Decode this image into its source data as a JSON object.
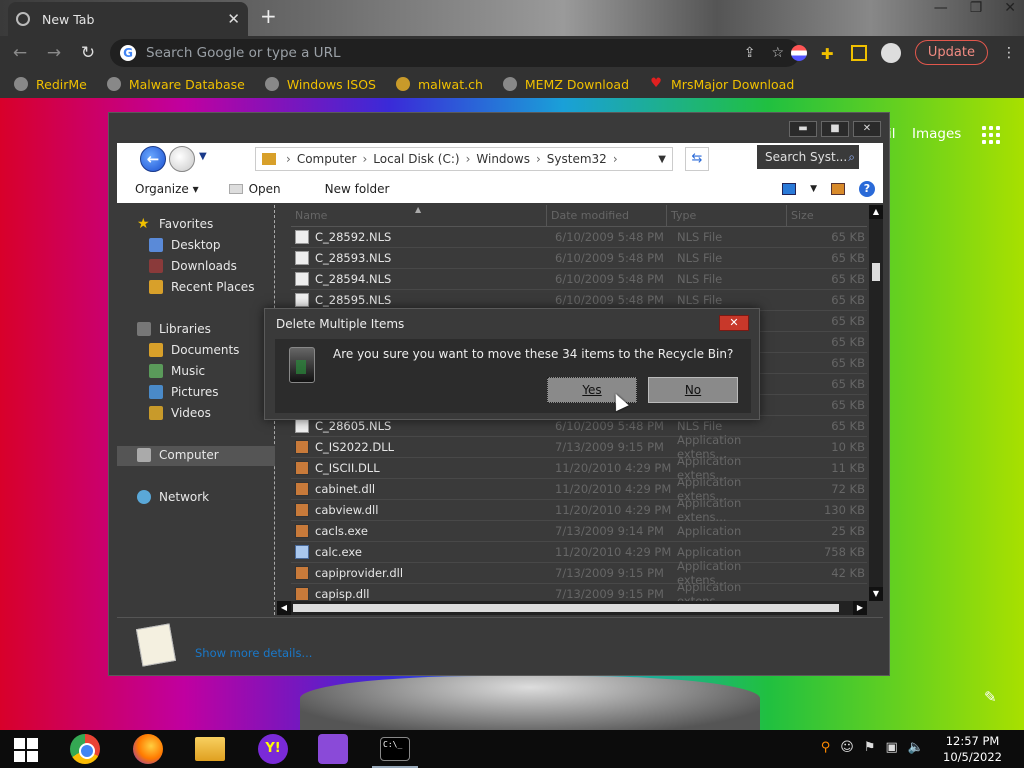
{
  "browser": {
    "tab_title": "New Tab",
    "omnibox_placeholder": "Search Google or type a URL",
    "update_label": "Update",
    "bookmarks": [
      "RedirMe",
      "Malware Database",
      "Windows ISOS",
      "malwat.ch",
      "MEMZ Download",
      "MrsMajor Download"
    ]
  },
  "page": {
    "gmail_partial": "il",
    "images_label": "Images"
  },
  "explorer": {
    "breadcrumb": [
      "Computer",
      "Local Disk (C:)",
      "Windows",
      "System32"
    ],
    "search_placeholder": "Search Syst...",
    "commands": {
      "organize": "Organize",
      "open": "Open",
      "new_folder": "New folder"
    },
    "nav": {
      "favorites": "Favorites",
      "desktop": "Desktop",
      "downloads": "Downloads",
      "recent_places": "Recent Places",
      "libraries": "Libraries",
      "documents": "Documents",
      "music": "Music",
      "pictures": "Pictures",
      "videos": "Videos",
      "computer": "Computer",
      "network": "Network"
    },
    "columns": {
      "name": "Name",
      "date": "Date modified",
      "type": "Type",
      "size": "Size"
    },
    "files": [
      {
        "name": "C_28592.NLS",
        "date": "6/10/2009 5:48 PM",
        "type": "NLS File",
        "size": "65 KB",
        "kind": "nls"
      },
      {
        "name": "C_28593.NLS",
        "date": "6/10/2009 5:48 PM",
        "type": "NLS File",
        "size": "65 KB",
        "kind": "nls"
      },
      {
        "name": "C_28594.NLS",
        "date": "6/10/2009 5:48 PM",
        "type": "NLS File",
        "size": "65 KB",
        "kind": "nls"
      },
      {
        "name": "C_28595.NLS",
        "date": "6/10/2009 5:48 PM",
        "type": "NLS File",
        "size": "65 KB",
        "kind": "nls"
      },
      {
        "name": "",
        "date": "",
        "type": "",
        "size": "65 KB",
        "kind": "hidden"
      },
      {
        "name": "",
        "date": "",
        "type": "",
        "size": "65 KB",
        "kind": "hidden"
      },
      {
        "name": "",
        "date": "",
        "type": "",
        "size": "65 KB",
        "kind": "hidden"
      },
      {
        "name": "",
        "date": "",
        "type": "",
        "size": "65 KB",
        "kind": "hidden"
      },
      {
        "name": "",
        "date": "",
        "type": "",
        "size": "65 KB",
        "kind": "hidden"
      },
      {
        "name": "C_28605.NLS",
        "date": "6/10/2009 5:48 PM",
        "type": "NLS File",
        "size": "65 KB",
        "kind": "nls"
      },
      {
        "name": "C_IS2022.DLL",
        "date": "7/13/2009 9:15 PM",
        "type": "Application extens...",
        "size": "10 KB",
        "kind": "dll"
      },
      {
        "name": "C_ISCII.DLL",
        "date": "11/20/2010 4:29 PM",
        "type": "Application extens...",
        "size": "11 KB",
        "kind": "dll"
      },
      {
        "name": "cabinet.dll",
        "date": "11/20/2010 4:29 PM",
        "type": "Application extens...",
        "size": "72 KB",
        "kind": "dll"
      },
      {
        "name": "cabview.dll",
        "date": "11/20/2010 4:29 PM",
        "type": "Application extens...",
        "size": "130 KB",
        "kind": "dll"
      },
      {
        "name": "cacls.exe",
        "date": "7/13/2009 9:14 PM",
        "type": "Application",
        "size": "25 KB",
        "kind": "dll"
      },
      {
        "name": "calc.exe",
        "date": "11/20/2010 4:29 PM",
        "type": "Application",
        "size": "758 KB",
        "kind": "exe"
      },
      {
        "name": "capiprovider.dll",
        "date": "7/13/2009 9:15 PM",
        "type": "Application extens...",
        "size": "42 KB",
        "kind": "dll"
      },
      {
        "name": "capisp.dll",
        "date": "7/13/2009 9:15 PM",
        "type": "Application extens...",
        "size": "",
        "kind": "dll"
      }
    ],
    "details_link": "Show more details..."
  },
  "dialog": {
    "title": "Delete Multiple Items",
    "message": "Are you sure you want to move these 34 items to the Recycle Bin?",
    "yes": "Yes",
    "no": "No"
  },
  "taskbar": {
    "time": "12:57 PM",
    "date": "10/5/2022",
    "cmd_text": "C:\\_"
  },
  "colors": {
    "accent_update": "#f28b82",
    "bookmark_text": "#f0c000",
    "close_red": "#c8382a"
  }
}
